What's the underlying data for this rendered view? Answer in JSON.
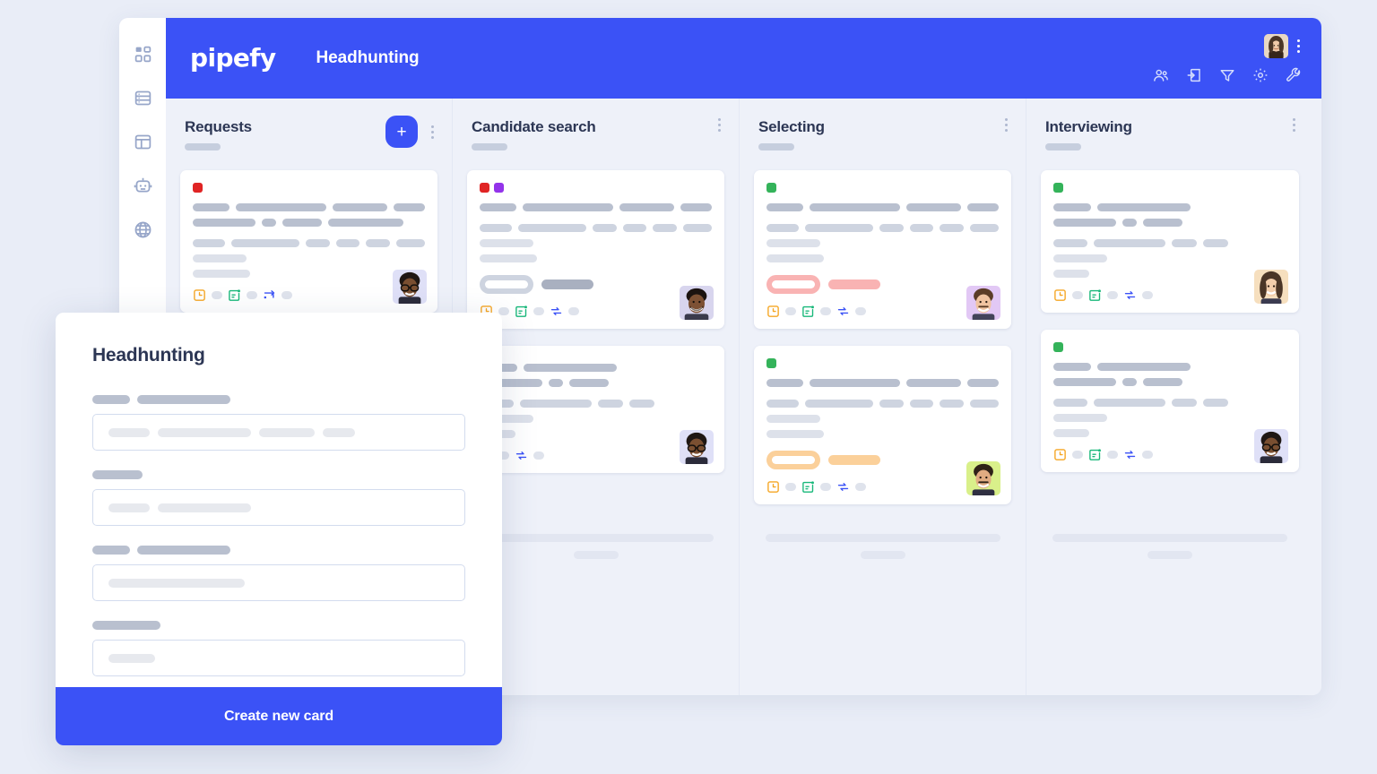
{
  "app": {
    "logo_text": "pipefy",
    "pipe_title": "Headhunting",
    "accent_color": "#3b52f6",
    "page_background": "#e9edf7",
    "board_background": "#eef1f9"
  },
  "sidebar": {
    "items": [
      {
        "icon": "apps-grid-icon"
      },
      {
        "icon": "database-icon"
      },
      {
        "icon": "layout-panel-icon"
      },
      {
        "icon": "robot-automation-icon"
      },
      {
        "icon": "globe-icon"
      }
    ]
  },
  "topbar": {
    "avatar": "user-avatar",
    "menu": "kebab-menu-icon",
    "tools": [
      {
        "icon": "members-icon"
      },
      {
        "icon": "inbox-import-icon"
      },
      {
        "icon": "filter-icon"
      },
      {
        "icon": "settings-gear-icon"
      },
      {
        "icon": "wrench-icon"
      }
    ]
  },
  "board": {
    "columns": [
      {
        "title": "Requests",
        "has_add_button": true,
        "add_label": "+",
        "cards": [
          {
            "labels": [
              "#e02424"
            ],
            "badges": [],
            "meta_icons": [
              "clock-square-icon",
              "calendar-check-icon",
              "flow-connect-icon"
            ],
            "avatar": "avatar-man-glasses",
            "avatar_bg": "#dfe0f7"
          }
        ]
      },
      {
        "title": "Candidate search",
        "has_add_button": false,
        "cards": [
          {
            "labels": [
              "#e02424",
              "#9333ea"
            ],
            "badges": [
              {
                "color": "#ced4e0"
              }
            ],
            "meta_icons": [
              "clock-square-icon",
              "calendar-check-icon",
              "sync-refresh-icon"
            ],
            "avatar": "avatar-man-beard",
            "avatar_bg": "#d8d5ee"
          },
          {
            "labels": [],
            "badges": [],
            "meta_icons": [
              "calendar-check-icon",
              "sync-refresh-icon"
            ],
            "avatar": "avatar-man-glasses",
            "avatar_bg": "#dfe0f7"
          }
        ]
      },
      {
        "title": "Selecting",
        "has_add_button": false,
        "cards": [
          {
            "labels": [
              "#34b35a"
            ],
            "badges": [
              {
                "color": "#f9b3b3"
              }
            ],
            "meta_icons": [
              "clock-square-icon",
              "calendar-check-icon",
              "sync-refresh-icon"
            ],
            "avatar": "avatar-man-smile",
            "avatar_bg": "#e2c8f5"
          },
          {
            "labels": [
              "#34b35a"
            ],
            "badges": [
              {
                "color": "#fbd09a"
              }
            ],
            "meta_icons": [
              "clock-square-icon",
              "calendar-check-icon",
              "sync-refresh-icon"
            ],
            "avatar": "avatar-man-smile",
            "avatar_bg": "#d9f08a"
          }
        ]
      },
      {
        "title": "Interviewing",
        "has_add_button": false,
        "cards": [
          {
            "labels": [
              "#34b35a"
            ],
            "badges": [],
            "meta_icons": [
              "clock-square-icon",
              "calendar-check-icon",
              "sync-refresh-icon"
            ],
            "avatar": "avatar-woman",
            "avatar_bg": "#f6dfbe"
          },
          {
            "labels": [
              "#34b35a"
            ],
            "badges": [],
            "meta_icons": [
              "clock-square-icon",
              "calendar-check-icon",
              "sync-refresh-icon"
            ],
            "avatar": "avatar-man-glasses",
            "avatar_bg": "#dfe0f7"
          }
        ]
      }
    ]
  },
  "modal": {
    "title": "Headhunting",
    "submit_label": "Create new card",
    "fields": [
      {
        "label_widths": [
          42,
          104
        ],
        "value_widths": [
          46,
          104,
          62,
          36
        ]
      },
      {
        "label_widths": [
          56
        ],
        "value_widths": [
          46,
          104
        ]
      },
      {
        "label_widths": [
          42,
          104
        ],
        "value_widths": [
          152
        ]
      },
      {
        "label_widths": [
          76
        ],
        "value_widths": [
          52
        ]
      }
    ]
  }
}
